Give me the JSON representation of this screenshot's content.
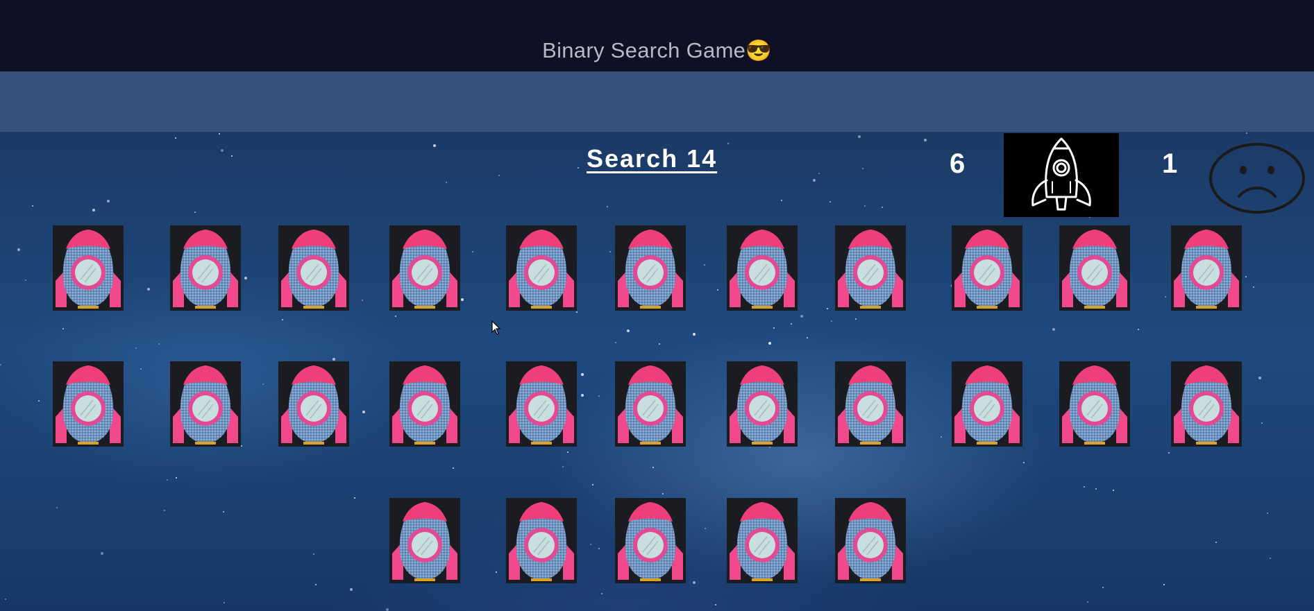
{
  "window": {
    "title": "Binary Search Game",
    "title_emoji": "😎"
  },
  "game": {
    "prompt": "Search 14",
    "attempts_count": "6",
    "second_count": "1",
    "status_icon": "sad-face-icon",
    "rocket_icon": "rocket-sketch-icon"
  },
  "grid": {
    "rows": [
      {
        "tiles": 11
      },
      {
        "tiles": 11
      },
      {
        "tiles": 5
      }
    ],
    "tile_icon": "rocket-egg-icon"
  },
  "colors": {
    "topbar": "#0f1024",
    "band": "#34527c",
    "rocket_body": "#6f93bf",
    "rocket_nose": "#ee3f7a",
    "rocket_fins": "#f2488c"
  }
}
